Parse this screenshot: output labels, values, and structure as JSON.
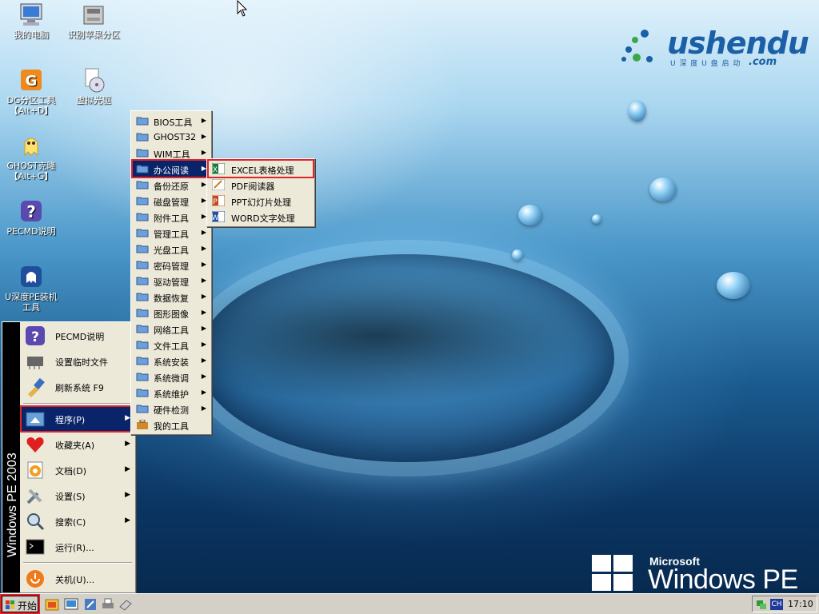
{
  "desktop": {
    "icons": [
      {
        "label": "我的电脑",
        "icon": "computer-icon"
      },
      {
        "label": "识别苹果分区",
        "icon": "disk-drive-icon"
      },
      {
        "label": "DG分区工具\n【Alt+D】",
        "icon": "diskgenius-icon"
      },
      {
        "label": "虚拟光驱",
        "icon": "virtual-cd-icon"
      },
      {
        "label": "GHOST克隆\n【Alt+G】",
        "icon": "ghost-icon"
      },
      {
        "label": "PECMD说明",
        "icon": "help-icon"
      },
      {
        "label": "U深度PE装机\n工具",
        "icon": "installer-icon"
      }
    ]
  },
  "branding": {
    "logo_word": "ushendu",
    "logo_sub": "U 深 度 U 盘 启 动",
    "logo_domain": ".com",
    "ms_label": "Microsoft",
    "os_name": "Windows PE",
    "strip_label": "Windows PE 2003"
  },
  "start_menu": {
    "items": [
      {
        "label": "PECMD说明",
        "icon": "help-icon",
        "arrow": false
      },
      {
        "label": "设置临时文件",
        "icon": "chip-icon",
        "arrow": false
      },
      {
        "label": "刷新系统 F9",
        "icon": "brush-icon",
        "arrow": false
      },
      {
        "label": "程序(P)",
        "icon": "programs-folder-icon",
        "arrow": true
      },
      {
        "label": "收藏夹(A)",
        "icon": "heart-icon",
        "arrow": true
      },
      {
        "label": "文档(D)",
        "icon": "documents-icon",
        "arrow": true
      },
      {
        "label": "设置(S)",
        "icon": "settings-icon",
        "arrow": true
      },
      {
        "label": "搜索(C)",
        "icon": "search-icon",
        "arrow": true
      },
      {
        "label": "运行(R)...",
        "icon": "run-icon",
        "arrow": false
      },
      {
        "label": "关机(U)...",
        "icon": "shutdown-icon",
        "arrow": false
      }
    ]
  },
  "programs_menu": {
    "items": [
      {
        "label": "BIOS工具",
        "arrow": true
      },
      {
        "label": "GHOST32",
        "arrow": true
      },
      {
        "label": "WIM工具",
        "arrow": true
      },
      {
        "label": "办公阅读",
        "arrow": true
      },
      {
        "label": "备份还原",
        "arrow": true
      },
      {
        "label": "磁盘管理",
        "arrow": true
      },
      {
        "label": "附件工具",
        "arrow": true
      },
      {
        "label": "管理工具",
        "arrow": true
      },
      {
        "label": "光盘工具",
        "arrow": true
      },
      {
        "label": "密码管理",
        "arrow": true
      },
      {
        "label": "驱动管理",
        "arrow": true
      },
      {
        "label": "数据恢复",
        "arrow": true
      },
      {
        "label": "图形图像",
        "arrow": true
      },
      {
        "label": "网络工具",
        "arrow": true
      },
      {
        "label": "文件工具",
        "arrow": true
      },
      {
        "label": "系统安装",
        "arrow": true
      },
      {
        "label": "系统微调",
        "arrow": true
      },
      {
        "label": "系统维护",
        "arrow": true
      },
      {
        "label": "硬件检测",
        "arrow": true
      },
      {
        "label": "我的工具",
        "arrow": false
      }
    ]
  },
  "office_menu": {
    "items": [
      {
        "label": "EXCEL表格处理",
        "icon": "excel-icon"
      },
      {
        "label": "PDF阅读器",
        "icon": "pdf-icon"
      },
      {
        "label": "PPT幻灯片处理",
        "icon": "ppt-icon"
      },
      {
        "label": "WORD文字处理",
        "icon": "word-icon"
      }
    ]
  },
  "taskbar": {
    "start_label": "开始",
    "ime_label": "CH",
    "clock": "17:10"
  },
  "colors": {
    "menu_bg": "#ece9d8",
    "highlight": "#0a246a",
    "annotation": "#e0242a",
    "taskbar": "#d4d0c8"
  }
}
